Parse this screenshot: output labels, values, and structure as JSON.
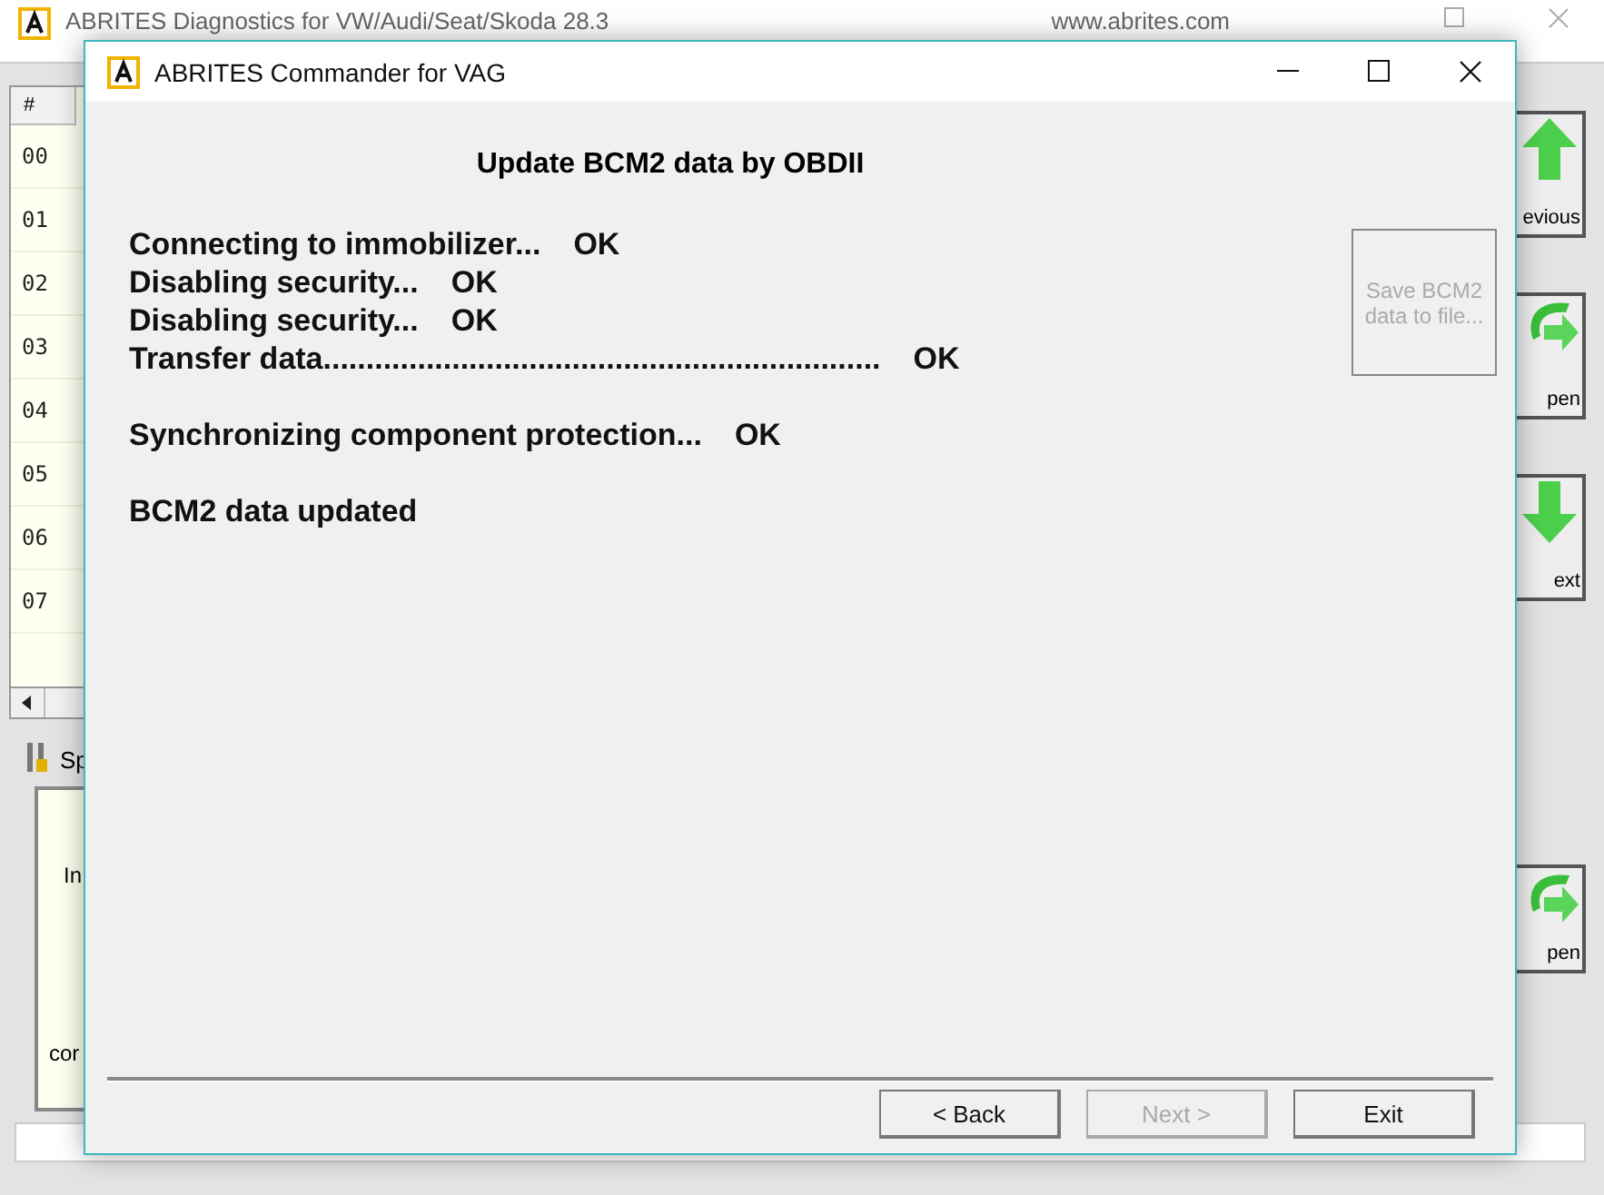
{
  "background_window": {
    "title": "ABRITES Diagnostics for VW/Audi/Seat/Skoda 28.3",
    "website": "www.abrites.com",
    "table": {
      "column_header": "#",
      "rows": [
        "00",
        "01",
        "02",
        "03",
        "04",
        "05",
        "06",
        "07"
      ]
    },
    "panel": {
      "label": "Sp",
      "texts": [
        "In",
        "cor"
      ]
    },
    "side_buttons": [
      {
        "label": "evious",
        "kind": "up"
      },
      {
        "label": "pen",
        "kind": "open"
      },
      {
        "label": "ext",
        "kind": "down"
      },
      {
        "label": "pen",
        "kind": "open"
      }
    ]
  },
  "dialog": {
    "title": "ABRITES Commander for VAG",
    "heading": "Update BCM2 data by OBDII",
    "log_groups": [
      {
        "lines": [
          {
            "text": "Connecting to immobilizer...",
            "status": "OK"
          },
          {
            "text": "Disabling security...",
            "status": "OK"
          },
          {
            "text": "Disabling security...",
            "status": "OK"
          },
          {
            "text": "Transfer data.................................................................",
            "status": "OK"
          }
        ]
      },
      {
        "lines": [
          {
            "text": "Synchronizing component protection...",
            "status": "OK"
          }
        ]
      },
      {
        "lines": [
          {
            "text": "BCM2 data updated"
          }
        ]
      }
    ],
    "save_button": {
      "label": "Save BCM2 data to file...",
      "disabled": true
    },
    "buttons": [
      {
        "label": "< Back",
        "disabled": false
      },
      {
        "label": "Next >",
        "disabled": true
      },
      {
        "label": "Exit",
        "disabled": false
      }
    ]
  }
}
